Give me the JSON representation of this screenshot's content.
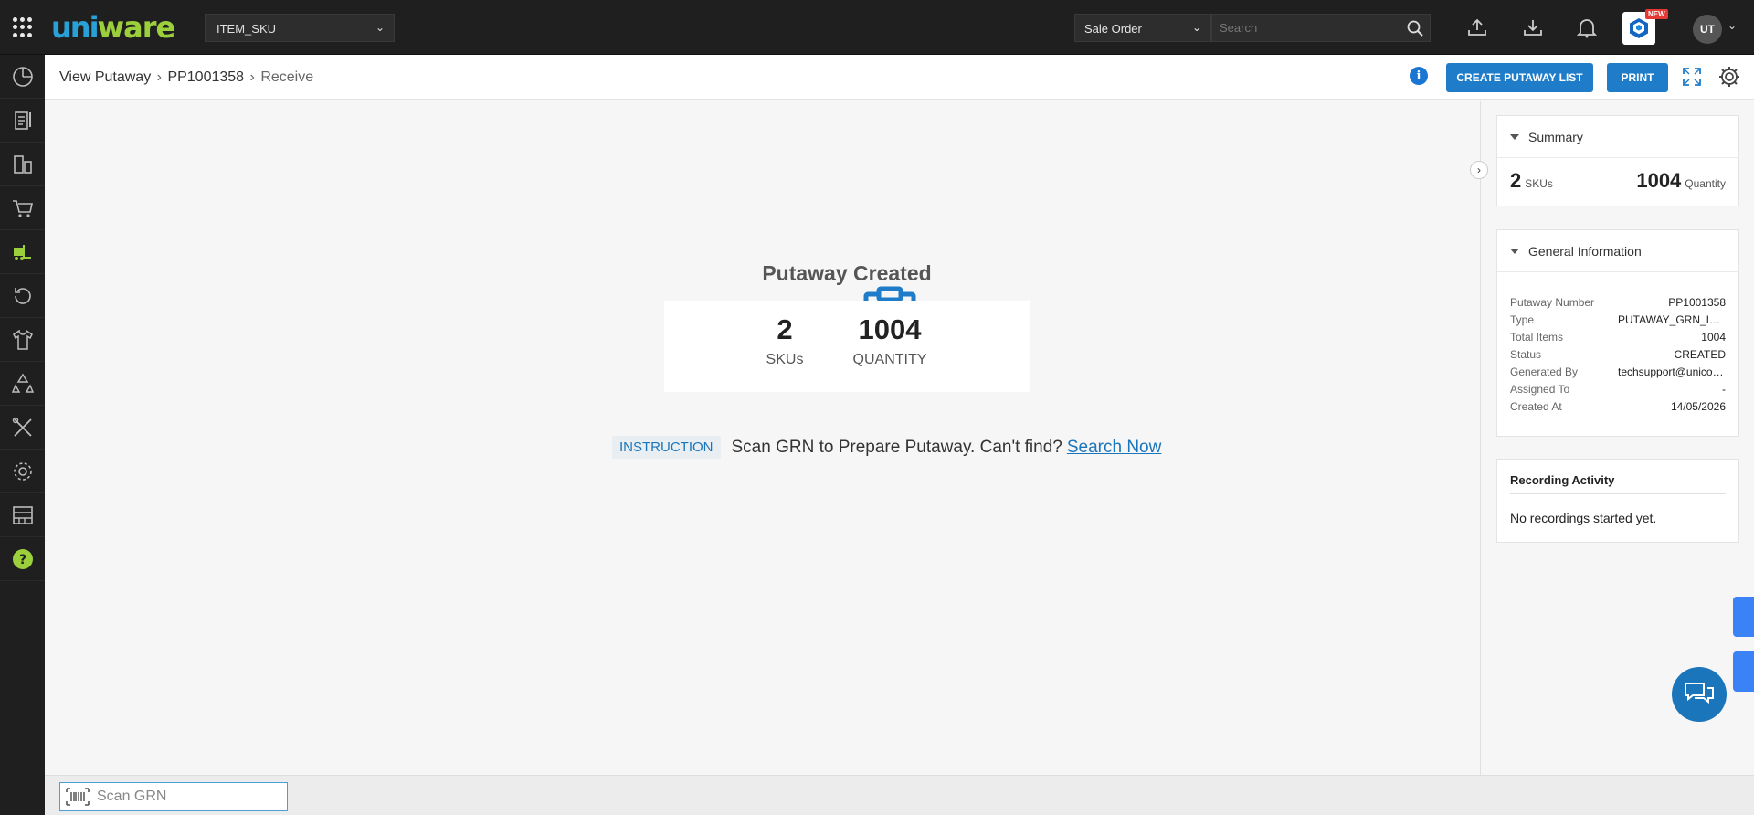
{
  "topbar": {
    "logo": {
      "part1": "uni",
      "part2": "ware"
    },
    "facility_select": "ITEM_SKU",
    "order_type_select": "Sale Order",
    "search_placeholder": "Search",
    "new_badge": "NEW",
    "user_initials": "UT",
    "icons": [
      "apps-grid-icon",
      "upload-icon",
      "download-icon",
      "bell-icon",
      "cube-icon",
      "chevron-down-icon"
    ]
  },
  "sidebar": {
    "items": [
      "dashboard-icon",
      "orders-icon",
      "returns-icon",
      "procurement-cart-icon",
      "putaway-forklift-icon",
      "refresh-icon",
      "shirt-product-icon",
      "recycle-icon",
      "tools-icon",
      "settings-icon",
      "warehouse-shelf-icon",
      "help-icon"
    ],
    "active_item": "putaway-forklift-icon"
  },
  "header": {
    "breadcrumb": [
      "View Putaway",
      "PP1001358",
      "Receive"
    ],
    "create_putaway_list_label": "CREATE PUTAWAY LIST",
    "print_label": "PRINT"
  },
  "main": {
    "status_title": "Putaway Created",
    "skus_count": "2",
    "skus_label": "SKUs",
    "quantity_count": "1004",
    "quantity_label": "QUANTITY",
    "instruction_tag": "INSTRUCTION",
    "instruction_text": "Scan GRN to Prepare Putaway. Can't find?",
    "instruction_link": "Search Now"
  },
  "summary": {
    "title": "Summary",
    "skus": "2",
    "skus_label": "SKUs",
    "quantity": "1004",
    "quantity_label": "Quantity"
  },
  "general_info": {
    "title": "General Information",
    "rows": [
      {
        "key": "Putaway Number",
        "value": "PP1001358"
      },
      {
        "key": "Type",
        "value": "PUTAWAY_GRN_ITEM"
      },
      {
        "key": "Total Items",
        "value": "1004"
      },
      {
        "key": "Status",
        "value": "CREATED"
      },
      {
        "key": "Generated By",
        "value": "techsupport@unicommerce.com"
      },
      {
        "key": "Assigned To",
        "value": "-"
      },
      {
        "key": "Created At",
        "value": "14/05/2026"
      }
    ]
  },
  "recording": {
    "title": "Recording Activity",
    "message": "No recordings started yet."
  },
  "bottom": {
    "scan_placeholder": "Scan GRN"
  },
  "colors": {
    "accent": "#1e7cc8",
    "topbar": "#1f1f1f",
    "active_sidebar_icon": "#9ccf3c",
    "help_icon": "#9ccf3c"
  }
}
